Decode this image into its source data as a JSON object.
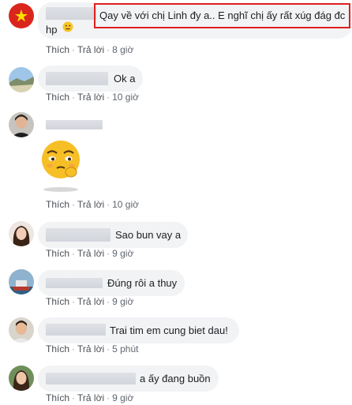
{
  "colors": {
    "bubble": "#f2f3f5",
    "meta_text": "#606770",
    "highlight": "#e02020"
  },
  "comments": [
    {
      "avatar_icon": "vietnam-flag-avatar",
      "text_line1": "Qay về với chị Linh đy a.. E nghĩ chị ấy rất xúg đág đc",
      "text_line2": "hp",
      "emoji": "😐",
      "like": "Thích",
      "reply": "Trả lời",
      "time": "8 giờ"
    },
    {
      "avatar_icon": "landscape-avatar",
      "text": "Ok a",
      "like": "Thích",
      "reply": "Trả lời",
      "time": "10 giờ"
    },
    {
      "avatar_icon": "man-avatar",
      "text": "",
      "sticker_icon": "pleading-emoji-sticker",
      "like": "Thích",
      "reply": "Trả lời",
      "time": "10 giờ"
    },
    {
      "avatar_icon": "woman-avatar",
      "text": "Sao bun vay a",
      "like": "Thích",
      "reply": "Trả lời",
      "time": "9 giờ"
    },
    {
      "avatar_icon": "boat-avatar",
      "text": "Đúng rôi a thuy",
      "like": "Thích",
      "reply": "Trả lời",
      "time": "9 giờ"
    },
    {
      "avatar_icon": "man-avatar",
      "text": "Trai tim em cung biet dau!",
      "like": "Thích",
      "reply": "Trả lời",
      "time": "5 phút"
    },
    {
      "avatar_icon": "woman-avatar",
      "text": "a ấy đang buồn",
      "like": "Thích",
      "reply": "Trả lời",
      "time": "9 giờ"
    }
  ]
}
